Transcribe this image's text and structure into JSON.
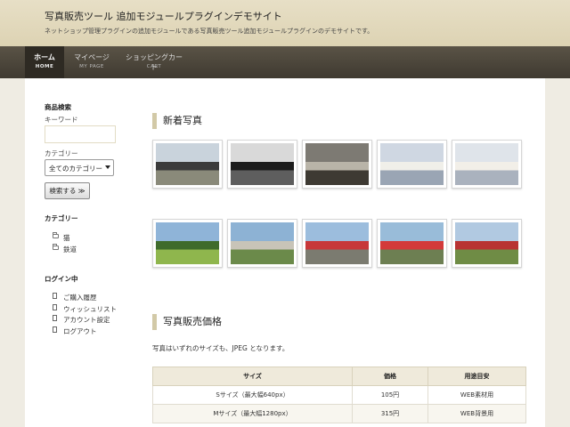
{
  "header": {
    "title": "写真販売ツール 追加モジュールプラグインデモサイト",
    "description": "ネットショップ管理プラグインの追加モジュールである写真販売ツール追加モジュールプラグインのデモサイトです。"
  },
  "nav": [
    {
      "label": "ホーム",
      "sub": "HOME",
      "active": true
    },
    {
      "label": "マイページ",
      "sub": "MY PAGE",
      "active": false
    },
    {
      "label": "ショッピングカート",
      "sub": "CART",
      "active": false
    }
  ],
  "sidebar": {
    "search_heading": "商品検索",
    "keyword_label": "キーワード",
    "keyword_value": "",
    "category_label": "カテゴリー",
    "category_selected": "全てのカテゴリー",
    "search_button": "検索する ≫",
    "category_heading": "カテゴリー",
    "categories": [
      "猫",
      "鉄道"
    ],
    "login_heading": "ログイン中",
    "login_links": [
      "ご購入履歴",
      "ウィッシュリスト",
      "アカウント設定",
      "ログアウト"
    ]
  },
  "main": {
    "new_photos_title": "新着写真",
    "photos_row1": [
      {
        "icon": "train-station-photo",
        "sky": "#c9d3dc",
        "ground": "#8a8a7a",
        "accent": "#3b3b3b"
      },
      {
        "icon": "steam-locomotive-photo",
        "sky": "#d9d9d9",
        "ground": "#5e5e5e",
        "accent": "#1c1c1c"
      },
      {
        "icon": "locomotive-cab-photo",
        "sky": "#7d7a73",
        "ground": "#3e3a33",
        "accent": "#b9b4a8"
      },
      {
        "icon": "cat-on-bench-photo",
        "sky": "#cfd7e2",
        "ground": "#9aa5b4",
        "accent": "#f0efe9"
      },
      {
        "icon": "cat-on-bench-photo",
        "sky": "#dfe4ea",
        "ground": "#aab2be",
        "accent": "#f2efe8"
      }
    ],
    "photos_row2": [
      {
        "icon": "green-field-photo",
        "sky": "#8fb4d8",
        "ground": "#8fb64d",
        "accent": "#3f6b2c"
      },
      {
        "icon": "rural-town-photo",
        "sky": "#8db2d4",
        "ground": "#6b8a4a",
        "accent": "#c8c4b8"
      },
      {
        "icon": "red-train-photo",
        "sky": "#9cbddd",
        "ground": "#7b7b70",
        "accent": "#c7383a"
      },
      {
        "icon": "red-train-photo",
        "sky": "#99bcd9",
        "ground": "#6d7f52",
        "accent": "#d33a3a"
      },
      {
        "icon": "red-train-photo",
        "sky": "#b1c9e1",
        "ground": "#6f8c45",
        "accent": "#b83333"
      }
    ],
    "price_title": "写真販売価格",
    "price_note": "写真はいずれのサイズも、JPEG となります。",
    "table": {
      "headers": [
        "サイズ",
        "価格",
        "用途目安"
      ],
      "rows": [
        [
          "Sサイズ（最大幅640px）",
          "105円",
          "WEB素材用"
        ],
        [
          "Mサイズ（最大幅1280px）",
          "315円",
          "WEB背景用"
        ]
      ]
    }
  },
  "colors": {
    "accent_bar": "#d2c9a7",
    "nav_bg": "#4a443a",
    "header_bg": "#e2d9bc"
  }
}
